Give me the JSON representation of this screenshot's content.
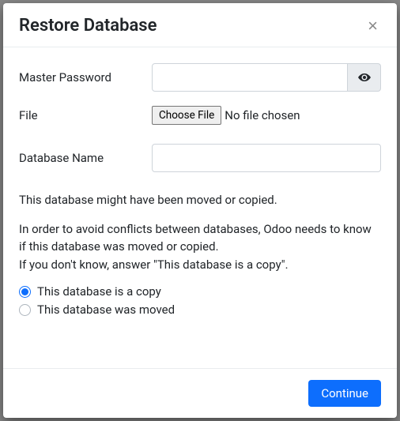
{
  "modal": {
    "title": "Restore Database",
    "close_label": "×"
  },
  "form": {
    "password_label": "Master Password",
    "password_value": "",
    "file_label": "File",
    "choose_file_btn": "Choose File",
    "file_status": "No file chosen",
    "dbname_label": "Database Name",
    "dbname_value": ""
  },
  "info": {
    "line1": "This database might have been moved or copied.",
    "line2": "In order to avoid conflicts between databases, Odoo needs to know if this database was moved or copied.",
    "line3": "If you don't know, answer \"This database is a copy\"."
  },
  "radio": {
    "option_copy": "This database is a copy",
    "option_moved": "This database was moved"
  },
  "footer": {
    "continue": "Continue"
  },
  "icons": {
    "eye": "eye-icon",
    "close": "close-icon"
  }
}
